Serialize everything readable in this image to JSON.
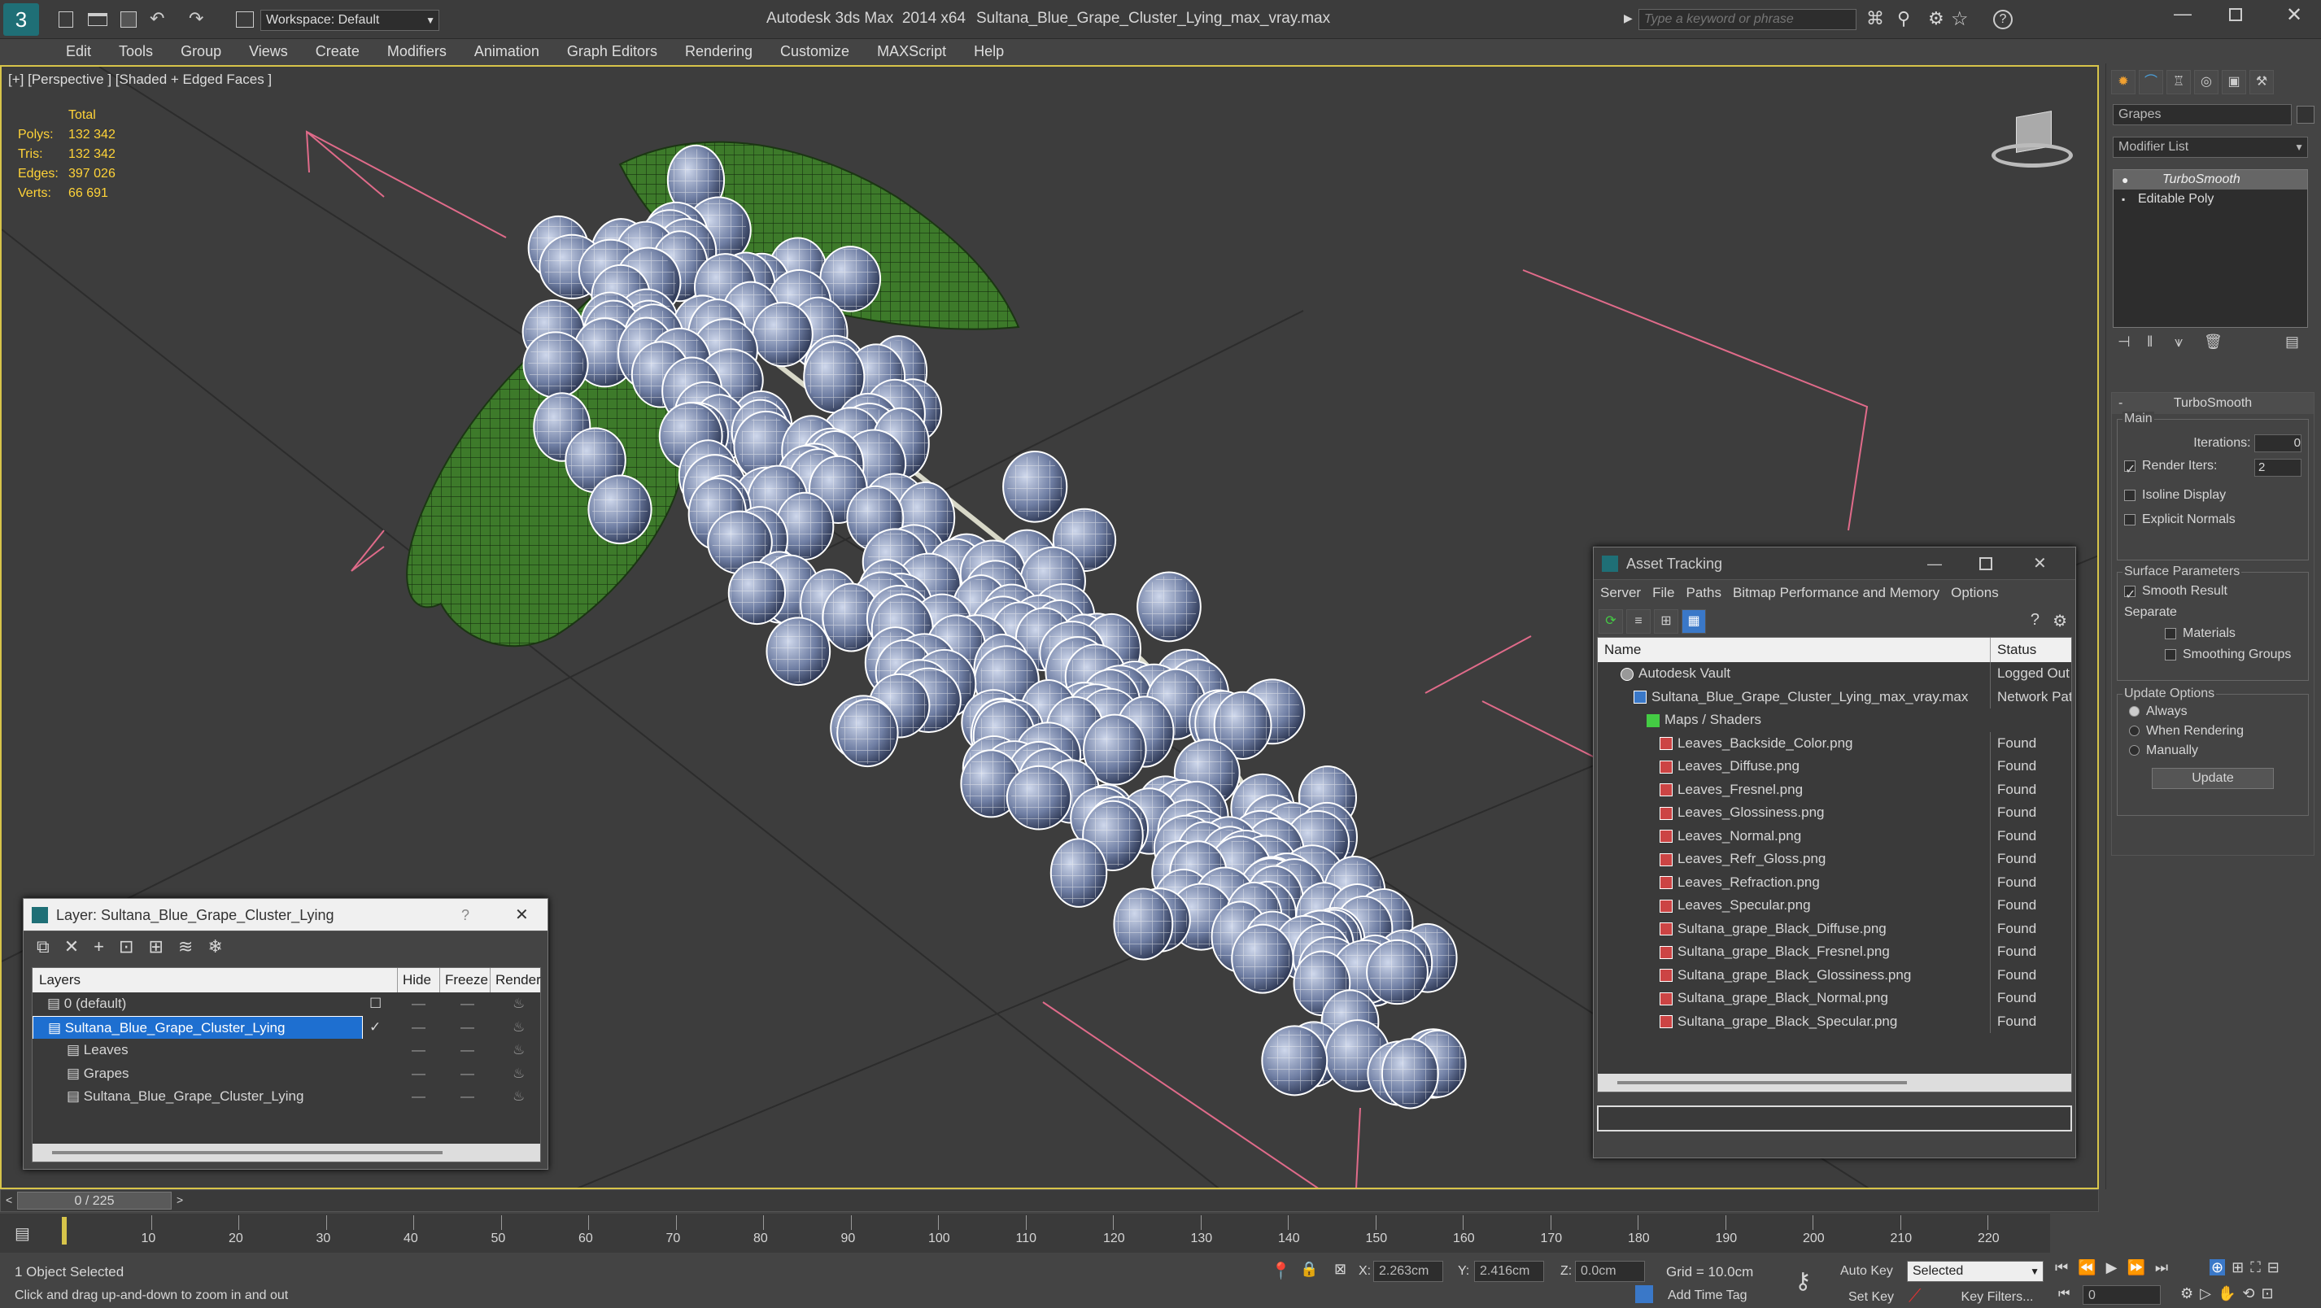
{
  "titlebar": {
    "workspace": "Workspace: Default",
    "app_title": "Autodesk 3ds Max  2014 x64",
    "file_title": "Sultana_Blue_Grape_Cluster_Lying_max_vray.max",
    "search_placeholder": "Type a keyword or phrase"
  },
  "menu": [
    "Edit",
    "Tools",
    "Group",
    "Views",
    "Create",
    "Modifiers",
    "Animation",
    "Graph Editors",
    "Rendering",
    "Customize",
    "MAXScript",
    "Help"
  ],
  "viewport": {
    "label": "[+] [Perspective ] [Shaded + Edged Faces ]",
    "stats_header": "Total",
    "stats": [
      {
        "label": "Polys:",
        "value": "132 342"
      },
      {
        "label": "Tris:",
        "value": "132 342"
      },
      {
        "label": "Edges:",
        "value": "397 026"
      },
      {
        "label": "Verts:",
        "value": "66 691"
      }
    ]
  },
  "command_panel": {
    "object_name": "Grapes",
    "modifier_list": "Modifier List",
    "stack": [
      "TurboSmooth",
      "Editable Poly"
    ],
    "rollout_title": "TurboSmooth",
    "main_group": "Main",
    "iterations_label": "Iterations:",
    "iterations_value": "0",
    "render_iters_label": "Render Iters:",
    "render_iters_value": "2",
    "isoline": "Isoline Display",
    "explicit_normals": "Explicit Normals",
    "surface_group": "Surface Parameters",
    "smooth_result": "Smooth Result",
    "separate": "Separate",
    "materials": "Materials",
    "smoothing_groups": "Smoothing Groups",
    "update_group": "Update Options",
    "always": "Always",
    "when_rendering": "When Rendering",
    "manually": "Manually",
    "update_btn": "Update"
  },
  "asset_tracking": {
    "title": "Asset Tracking",
    "menu": [
      "Server",
      "File",
      "Paths",
      "Bitmap Performance and Memory",
      "Options"
    ],
    "col_name": "Name",
    "col_status": "Status",
    "rows": [
      {
        "name": "Autodesk Vault",
        "status": "Logged Out",
        "indent": 1,
        "icon": "vault"
      },
      {
        "name": "Sultana_Blue_Grape_Cluster_Lying_max_vray.max",
        "status": "Network Pat",
        "indent": 2,
        "icon": "max"
      },
      {
        "name": "Maps / Shaders",
        "status": "",
        "indent": 3,
        "icon": "folder"
      },
      {
        "name": "Leaves_Backside_Color.png",
        "status": "Found",
        "indent": 4,
        "icon": "png"
      },
      {
        "name": "Leaves_Diffuse.png",
        "status": "Found",
        "indent": 4,
        "icon": "png"
      },
      {
        "name": "Leaves_Fresnel.png",
        "status": "Found",
        "indent": 4,
        "icon": "png"
      },
      {
        "name": "Leaves_Glossiness.png",
        "status": "Found",
        "indent": 4,
        "icon": "png"
      },
      {
        "name": "Leaves_Normal.png",
        "status": "Found",
        "indent": 4,
        "icon": "png"
      },
      {
        "name": "Leaves_Refr_Gloss.png",
        "status": "Found",
        "indent": 4,
        "icon": "png"
      },
      {
        "name": "Leaves_Refraction.png",
        "status": "Found",
        "indent": 4,
        "icon": "png"
      },
      {
        "name": "Leaves_Specular.png",
        "status": "Found",
        "indent": 4,
        "icon": "png"
      },
      {
        "name": "Sultana_grape_Black_Diffuse.png",
        "status": "Found",
        "indent": 4,
        "icon": "png"
      },
      {
        "name": "Sultana_grape_Black_Fresnel.png",
        "status": "Found",
        "indent": 4,
        "icon": "png"
      },
      {
        "name": "Sultana_grape_Black_Glossiness.png",
        "status": "Found",
        "indent": 4,
        "icon": "png"
      },
      {
        "name": "Sultana_grape_Black_Normal.png",
        "status": "Found",
        "indent": 4,
        "icon": "png"
      },
      {
        "name": "Sultana_grape_Black_Specular.png",
        "status": "Found",
        "indent": 4,
        "icon": "png"
      }
    ]
  },
  "layer_window": {
    "title": "Layer: Sultana_Blue_Grape_Cluster_Lying",
    "help": "?",
    "col_layers": "Layers",
    "col_hide": "Hide",
    "col_freeze": "Freeze",
    "col_render": "Render",
    "rows": [
      {
        "name": "0 (default)",
        "indent": 0,
        "selected": false
      },
      {
        "name": "Sultana_Blue_Grape_Cluster_Lying",
        "indent": 0,
        "selected": true
      },
      {
        "name": "Leaves",
        "indent": 1,
        "selected": false
      },
      {
        "name": "Grapes",
        "indent": 1,
        "selected": false
      },
      {
        "name": "Sultana_Blue_Grape_Cluster_Lying",
        "indent": 1,
        "selected": false
      }
    ]
  },
  "timeline": {
    "frame_counter": "0 / 225",
    "ticks": [
      "10",
      "20",
      "30",
      "40",
      "50",
      "60",
      "70",
      "80",
      "90",
      "100",
      "110",
      "120",
      "130",
      "140",
      "150",
      "160",
      "170",
      "180",
      "190",
      "200",
      "210",
      "220"
    ]
  },
  "status": {
    "selection": "1 Object Selected",
    "prompt": "Click and drag up-and-down to zoom in and out",
    "x_label": "X:",
    "x_value": "2.263cm",
    "y_label": "Y:",
    "y_value": "2.416cm",
    "z_label": "Z:",
    "z_value": "0.0cm",
    "grid": "Grid = 10.0cm",
    "add_time_tag": "Add Time Tag",
    "auto_key": "Auto Key",
    "set_key": "Set Key",
    "selected_option": "Selected",
    "key_filters": "Key Filters...",
    "current_frame": "0"
  }
}
